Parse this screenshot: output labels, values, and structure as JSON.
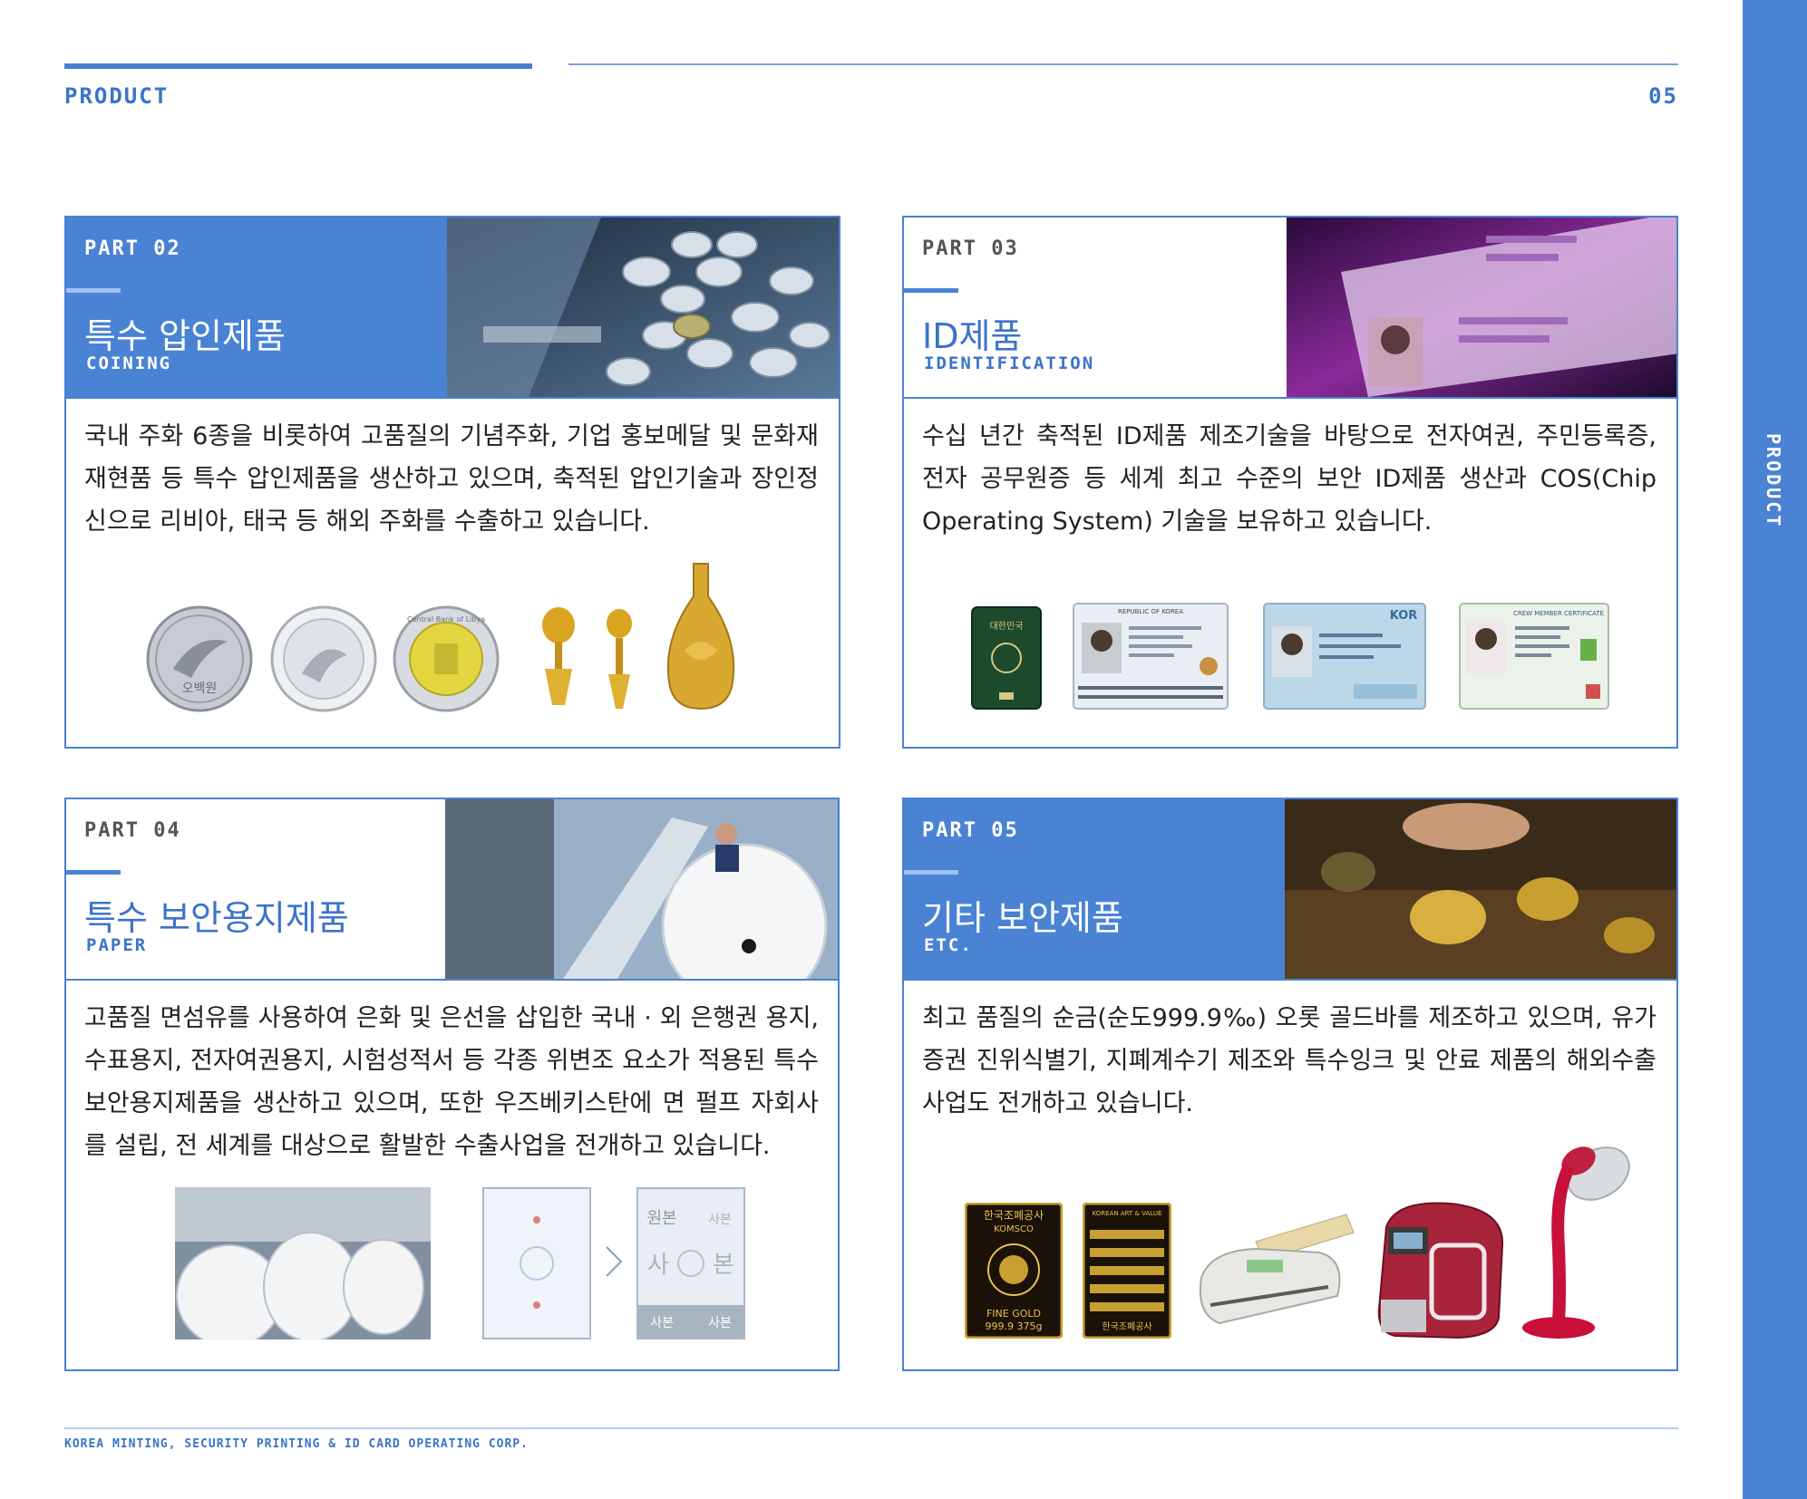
{
  "header": {
    "label": "PRODUCT",
    "page_number": "05"
  },
  "side_tab": {
    "label": "PRODUCT"
  },
  "footer": {
    "company": "KOREA MINTING, SECURITY PRINTING & ID CARD OPERATING CORP."
  },
  "cards": [
    {
      "part": "PART 02",
      "title": "특수 압인제품",
      "subtitle": "COINING",
      "description": "국내 주화 6종을 비롯하여 고품질의 기념주화, 기업 홍보메달 및 문화재 재현품 등 특수 압인제품을 생산하고 있으며, 축적된 압인기술과 장인정신으로 리비아, 태국 등 해외 주화를 수출하고 있습니다.",
      "images": {
        "coin1_text": "오백원",
        "coin3_text": "Central Bank of Libya"
      }
    },
    {
      "part": "PART 03",
      "title": "ID제품",
      "subtitle": "IDENTIFICATION",
      "description": "수십 년간 축적된 ID제품 제조기술을 바탕으로 전자여권, 주민등록증, 전자 공무원증 등 세계 최고 수준의 보안 ID제품 생산과 COS(Chip Operating System) 기술을 보유하고 있습니다.",
      "images": {
        "passport_text": "대한민국",
        "card1_text": "REPUBLIC OF KOREA",
        "card2_text": "KOR",
        "card3_text": "CREW MEMBER CERTIFICATE"
      }
    },
    {
      "part": "PART 04",
      "title": "특수 보안용지제품",
      "subtitle": "PAPER",
      "description": "고품질 면섬유를 사용하여 은화 및 은선을 삽입한 국내 · 외 은행권 용지, 수표용지, 전자여권용지, 시험성적서 등 각종 위변조 요소가 적용된 특수 보안용지제품을 생산하고 있으며, 또한 우즈베키스탄에 면 펄프 자회사를 설립, 전 세계를 대상으로 활발한 수출사업을 전개하고 있습니다.",
      "images": {
        "copy_top_left": "원본",
        "copy_top_right": "사본",
        "copy_mid_left": "사",
        "copy_mid_right": "본",
        "copy_bot_left": "사본",
        "copy_bot_right": "사본"
      }
    },
    {
      "part": "PART 05",
      "title": "기타 보안제품",
      "subtitle": "ETC.",
      "description": "최고 품질의 순금(순도999.9‰) 오롯 골드바를 제조하고 있으며, 유가증권 진위식별기, 지폐계수기 제조와 특수잉크 및 안료 제품의 해외수출 사업도 전개하고 있습니다.",
      "images": {
        "gold1_top": "한국조폐공사",
        "gold1_brand": "KOMSCO",
        "gold1_bottom": "FINE GOLD",
        "gold1_weight": "999.9 375g",
        "gold2_top": "KOREAN ART & VALUE",
        "gold2_bottom": "한국조폐공사"
      }
    }
  ],
  "colors": {
    "accent": "#4a82d4",
    "heading": "#3b73c9"
  }
}
